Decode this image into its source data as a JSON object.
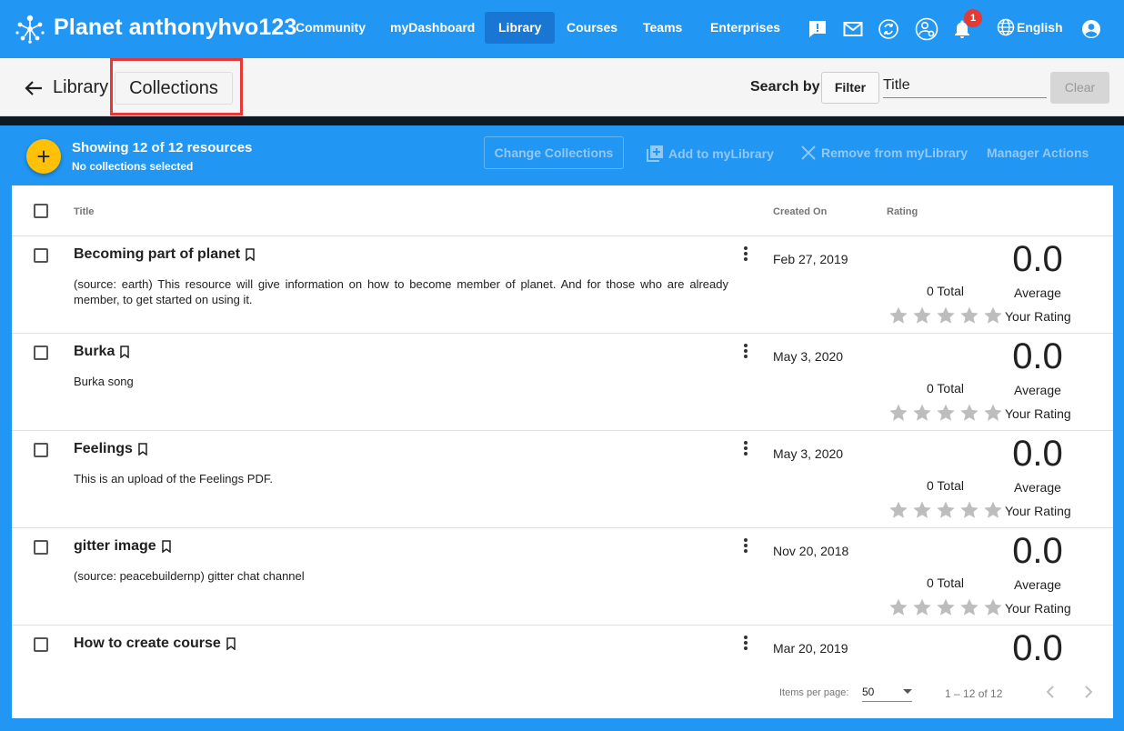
{
  "app": {
    "brand": "Planet anthonyhvo123",
    "nav": [
      {
        "label": "Community",
        "active": false
      },
      {
        "label": "myDashboard",
        "active": false
      },
      {
        "label": "Library",
        "active": true
      },
      {
        "label": "Courses",
        "active": false
      },
      {
        "label": "Teams",
        "active": false
      },
      {
        "label": "Enterprises",
        "active": false
      }
    ],
    "notification_count": "1",
    "language": "English",
    "colors": {
      "primary": "#2196f3",
      "primary_dark": "#1976d2",
      "accent": "#ffc107",
      "badge": "#e53935",
      "highlight": "#e53935"
    }
  },
  "subbar": {
    "title": "Library",
    "collections_label": "Collections",
    "search_by_label": "Search by:",
    "filter_label": "Filter",
    "search_value": "Title",
    "clear_label": "Clear"
  },
  "toolbar": {
    "showing": "Showing 12 of 12 resources",
    "collections_status": "No collections selected",
    "change_collections": "Change Collections",
    "add_to_mylibrary": "Add to myLibrary",
    "remove_from_mylibrary": "Remove from myLibrary",
    "manager_actions": "Manager Actions"
  },
  "table": {
    "headers": {
      "title": "Title",
      "created_on": "Created On",
      "rating": "Rating"
    },
    "rows": [
      {
        "title": "Becoming part of planet",
        "description": "(source: earth) This resource will give information on how to become member of planet. And for those who are already member, to get started on using it.",
        "date": "Feb 27, 2019",
        "total": "0 Total",
        "average": "0.0",
        "average_label": "Average",
        "your_rating": "Your Rating"
      },
      {
        "title": "Burka",
        "description": "Burka song",
        "date": "May 3, 2020",
        "total": "0 Total",
        "average": "0.0",
        "average_label": "Average",
        "your_rating": "Your Rating"
      },
      {
        "title": "Feelings",
        "description": "This is an upload of the Feelings PDF.",
        "date": "May 3, 2020",
        "total": "0 Total",
        "average": "0.0",
        "average_label": "Average",
        "your_rating": "Your Rating"
      },
      {
        "title": "gitter image",
        "description": "(source: peacebuildernp) gitter chat channel",
        "date": "Nov 20, 2018",
        "total": "0 Total",
        "average": "0.0",
        "average_label": "Average",
        "your_rating": "Your Rating"
      },
      {
        "title": "How to create course",
        "description": "",
        "date": "Mar 20, 2019",
        "total": "",
        "average": "0.0",
        "average_label": "",
        "your_rating": ""
      }
    ]
  },
  "paginator": {
    "items_per_page_label": "Items per page:",
    "items_per_page_value": "50",
    "range": "1 – 12 of 12"
  }
}
